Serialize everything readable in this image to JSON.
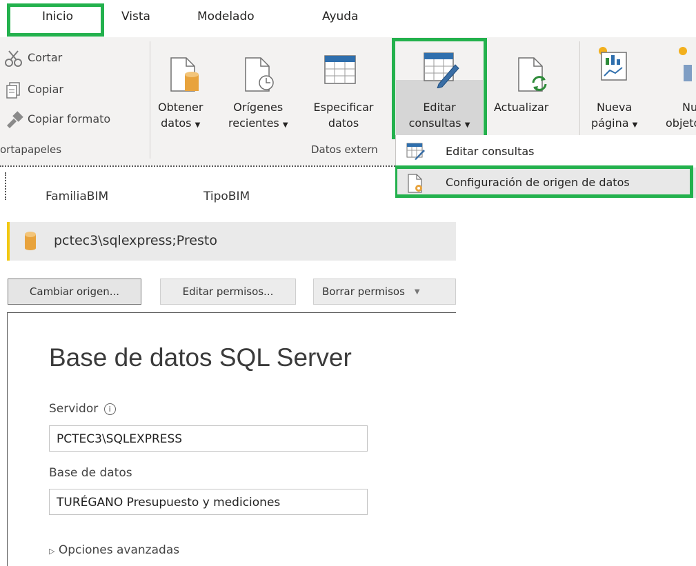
{
  "menu": {
    "tabs": [
      "Inicio",
      "Vista",
      "Modelado",
      "Ayuda"
    ]
  },
  "clipboard": {
    "cut": "Cortar",
    "copy": "Copiar",
    "copy_format": "Copiar formato",
    "group_label": "ortapapeles"
  },
  "ribbon": {
    "get_data": [
      "Obtener",
      "datos"
    ],
    "recent_sources": [
      "Orígenes",
      "recientes"
    ],
    "enter_data": [
      "Especificar",
      "datos"
    ],
    "edit_queries": [
      "Editar",
      "consultas"
    ],
    "refresh": "Actualizar",
    "new_page": [
      "Nueva",
      "página"
    ],
    "new_visual": [
      "Nu",
      "objeto"
    ],
    "external_group_label": "Datos extern"
  },
  "dropdown": {
    "items": [
      "Editar consultas",
      "Configuración de origen de datos"
    ]
  },
  "fields": [
    "FamiliaBIM",
    "TipoBIM"
  ],
  "data_source": {
    "name": "pctec3\\sqlexpress;Presto"
  },
  "buttons": {
    "change_source": "Cambiar origen...",
    "edit_permissions": "Editar permisos...",
    "clear_permissions": "Borrar permisos"
  },
  "dialog": {
    "title": "Base de datos SQL Server",
    "server_label": "Servidor",
    "server_value": "PCTEC3\\SQLEXPRESS",
    "database_label": "Base de datos",
    "database_value": "TURÉGANO Presupuesto y mediciones",
    "advanced_options": "Opciones avanzadas"
  },
  "colors": {
    "highlight": "#23b14d",
    "source_accent": "#f2c811",
    "ribbon_bg": "#f3f2f1"
  }
}
